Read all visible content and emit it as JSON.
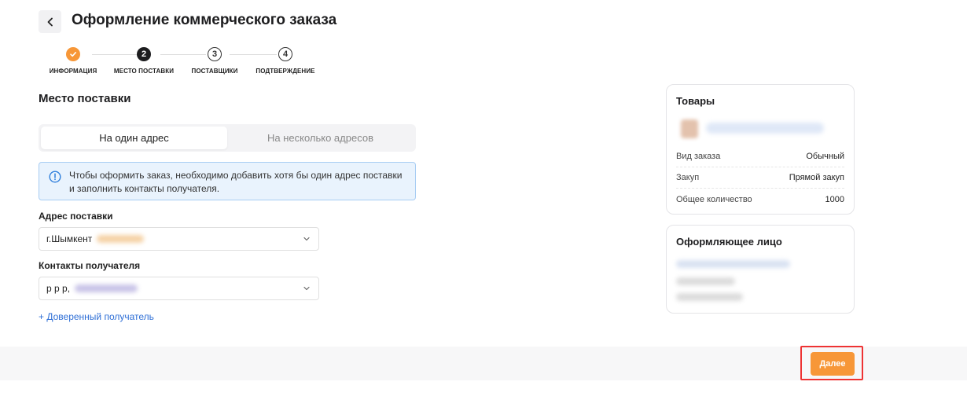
{
  "header": {
    "title": "Оформление коммерческого заказа",
    "back_icon": "chevron-left-icon"
  },
  "stepper": {
    "steps": [
      {
        "label": "ИНФОРМАЦИЯ",
        "number": "✓",
        "state": "done"
      },
      {
        "label": "МЕСТО ПОСТАВКИ",
        "number": "2",
        "state": "active"
      },
      {
        "label": "ПОСТАВЩИКИ",
        "number": "3",
        "state": "todo"
      },
      {
        "label": "ПОДТВЕРЖДЕНИЕ",
        "number": "4",
        "state": "todo"
      }
    ]
  },
  "delivery": {
    "title": "Место поставки",
    "tabs": [
      {
        "label": "На один адрес",
        "active": true
      },
      {
        "label": "На несколько адресов",
        "active": false
      }
    ],
    "info_text": "Чтобы оформить заказ, необходимо добавить хотя бы один адрес поставки и заполнить контакты получателя.",
    "address_label": "Адрес поставки",
    "address_value": "г.Шымкент",
    "contacts_label": "Контакты получателя",
    "contacts_value": "р р р,",
    "add_recipient_label": "+  Доверенный получатель"
  },
  "goods_card": {
    "title": "Товары",
    "rows": [
      {
        "key": "Вид заказа",
        "value": "Обычный"
      },
      {
        "key": "Закуп",
        "value": "Прямой закуп"
      },
      {
        "key": "Общее количество",
        "value": "1000"
      }
    ]
  },
  "issuer_card": {
    "title": "Оформляющее лицо"
  },
  "footer": {
    "next_label": "Далее"
  },
  "colors": {
    "accent": "#f79738",
    "info_bg": "#e9f3fd",
    "info_border": "#a8cdf3",
    "link": "#2f6fd6",
    "highlight": "#ee3333"
  }
}
